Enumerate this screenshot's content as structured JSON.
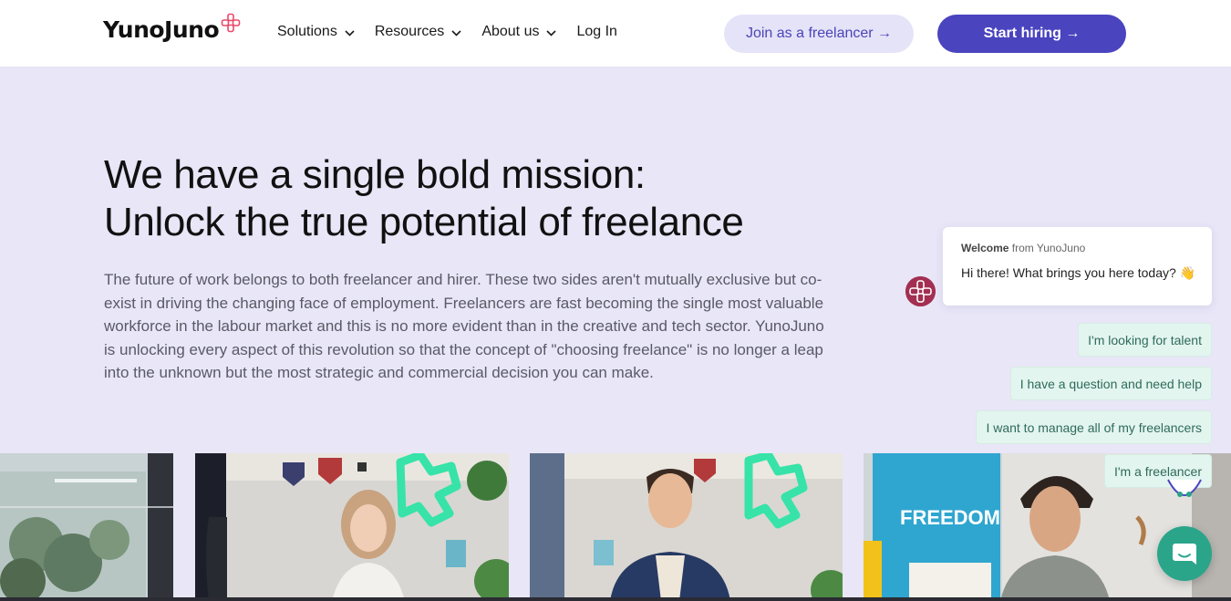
{
  "header": {
    "logo_text": "YunoJuno",
    "nav": [
      {
        "label": "Solutions",
        "icon": "chevron-down-icon"
      },
      {
        "label": "Resources",
        "icon": "chevron-down-icon"
      },
      {
        "label": "About us",
        "icon": "chevron-down-icon"
      }
    ],
    "login_label": "Log In",
    "join_label": "Join as a freelancer →",
    "hire_label": "Start hiring →"
  },
  "hero": {
    "title_line1": "We have a single bold mission:",
    "title_line2": "Unlock the true potential of freelance",
    "body": "The future of work belongs to both freelancer and hirer. These two sides aren't mutually exclusive but co-exist in driving the changing face of employment. Freelancers are fast becoming the single most valuable workforce in the labour market and this is no more evident than in the creative and tech sector. YunoJuno is unlocking every aspect of this revolution so that the concept of \"choosing freelance\" is no longer a leap into the unknown but the most strategic and commercial decision you can make."
  },
  "photos": {
    "poster_text": "FREEDOM"
  },
  "chat": {
    "welcome_bold": "Welcome",
    "welcome_rest": " from YunoJuno",
    "message": "Hi there! What brings you here today? 👋",
    "replies": [
      "I'm looking for talent",
      "I have a question and need help",
      "I want to manage all of my freelancers",
      "I'm a freelancer"
    ]
  },
  "colors": {
    "accent": "#4a44bf",
    "hero_bg": "#e8e6f7",
    "chat_green": "#2aa58a",
    "reply_bg": "#e3f5ef",
    "logo_mark": "#e84a6a"
  }
}
